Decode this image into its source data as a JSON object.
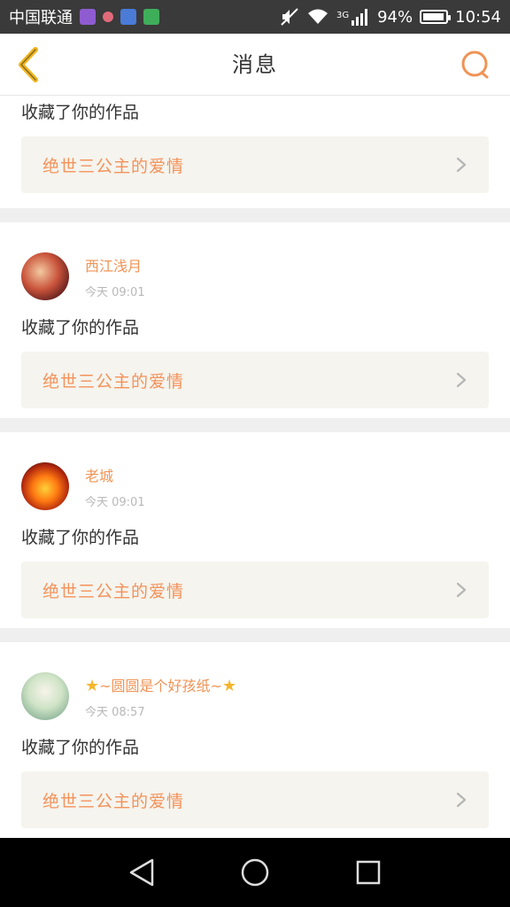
{
  "status_bar": {
    "carrier": "中国联通",
    "network": "3G",
    "battery": "94%",
    "time": "10:54",
    "battery_level": 0.94
  },
  "header": {
    "title": "消息"
  },
  "items": [
    {
      "partial": true,
      "action": "收藏了你的作品",
      "work_title": "绝世三公主的爱情"
    },
    {
      "username": "西江浅月",
      "time": "今天 09:01",
      "action": "收藏了你的作品",
      "work_title": "绝世三公主的爱情"
    },
    {
      "username": "老城",
      "time": "今天 09:01",
      "action": "收藏了你的作品",
      "work_title": "绝世三公主的爱情"
    },
    {
      "username": "~圆圆是个好孩纸~",
      "time": "今天 08:57",
      "action": "收藏了你的作品",
      "work_title": "绝世三公主的爱情"
    }
  ],
  "colors": {
    "accent": "#f09456",
    "card_bg": "#f5f4ee",
    "back_icon": "#f2b61a"
  }
}
